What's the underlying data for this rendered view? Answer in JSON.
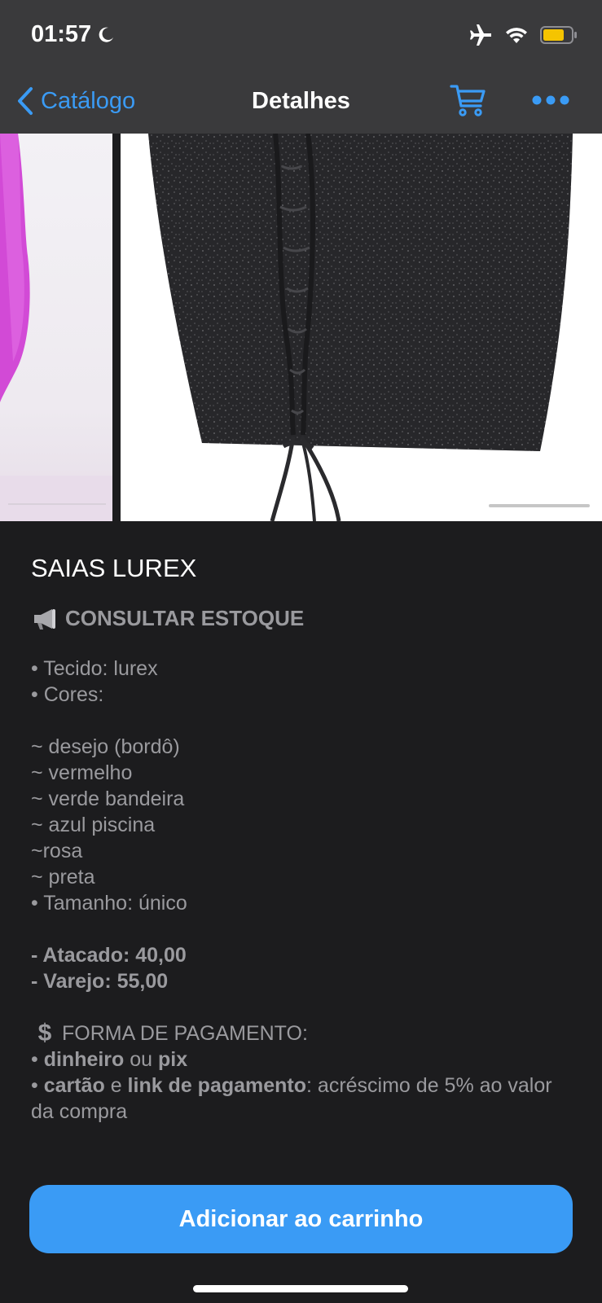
{
  "status_bar": {
    "time": "01:57",
    "icons": [
      "moon-icon",
      "airplane-icon",
      "wifi-icon",
      "battery-icon"
    ],
    "battery_color": "#f5c400"
  },
  "nav": {
    "back_label": "Catálogo",
    "title": "Detalhes",
    "accent_color": "#3a9bf5"
  },
  "product": {
    "title": "SAIAS LUREX",
    "stock_label": "CONSULTAR ESTOQUE",
    "details": [
      "• Tecido: lurex",
      "• Cores:",
      "",
      "~ desejo (bordô)",
      "~ vermelho",
      "~ verde bandeira",
      "~ azul piscina",
      "~rosa",
      "~ preta",
      "• Tamanho: único"
    ],
    "prices": {
      "wholesale": "- Atacado: 40,00",
      "retail": "- Varejo: 55,00"
    },
    "payment": {
      "title": "FORMA DE PAGAMENTO:",
      "line1": {
        "bullet": "• ",
        "method_a": "dinheiro",
        "conj": " ou ",
        "method_b": "pix"
      },
      "line2": {
        "bullet": "• ",
        "method_a": "cartão",
        "conj": " e ",
        "method_b": "link de pagamento",
        "note": ": acréscimo de 5% ao valor da compra"
      }
    }
  },
  "cta": {
    "label": "Adicionar ao carrinho"
  }
}
